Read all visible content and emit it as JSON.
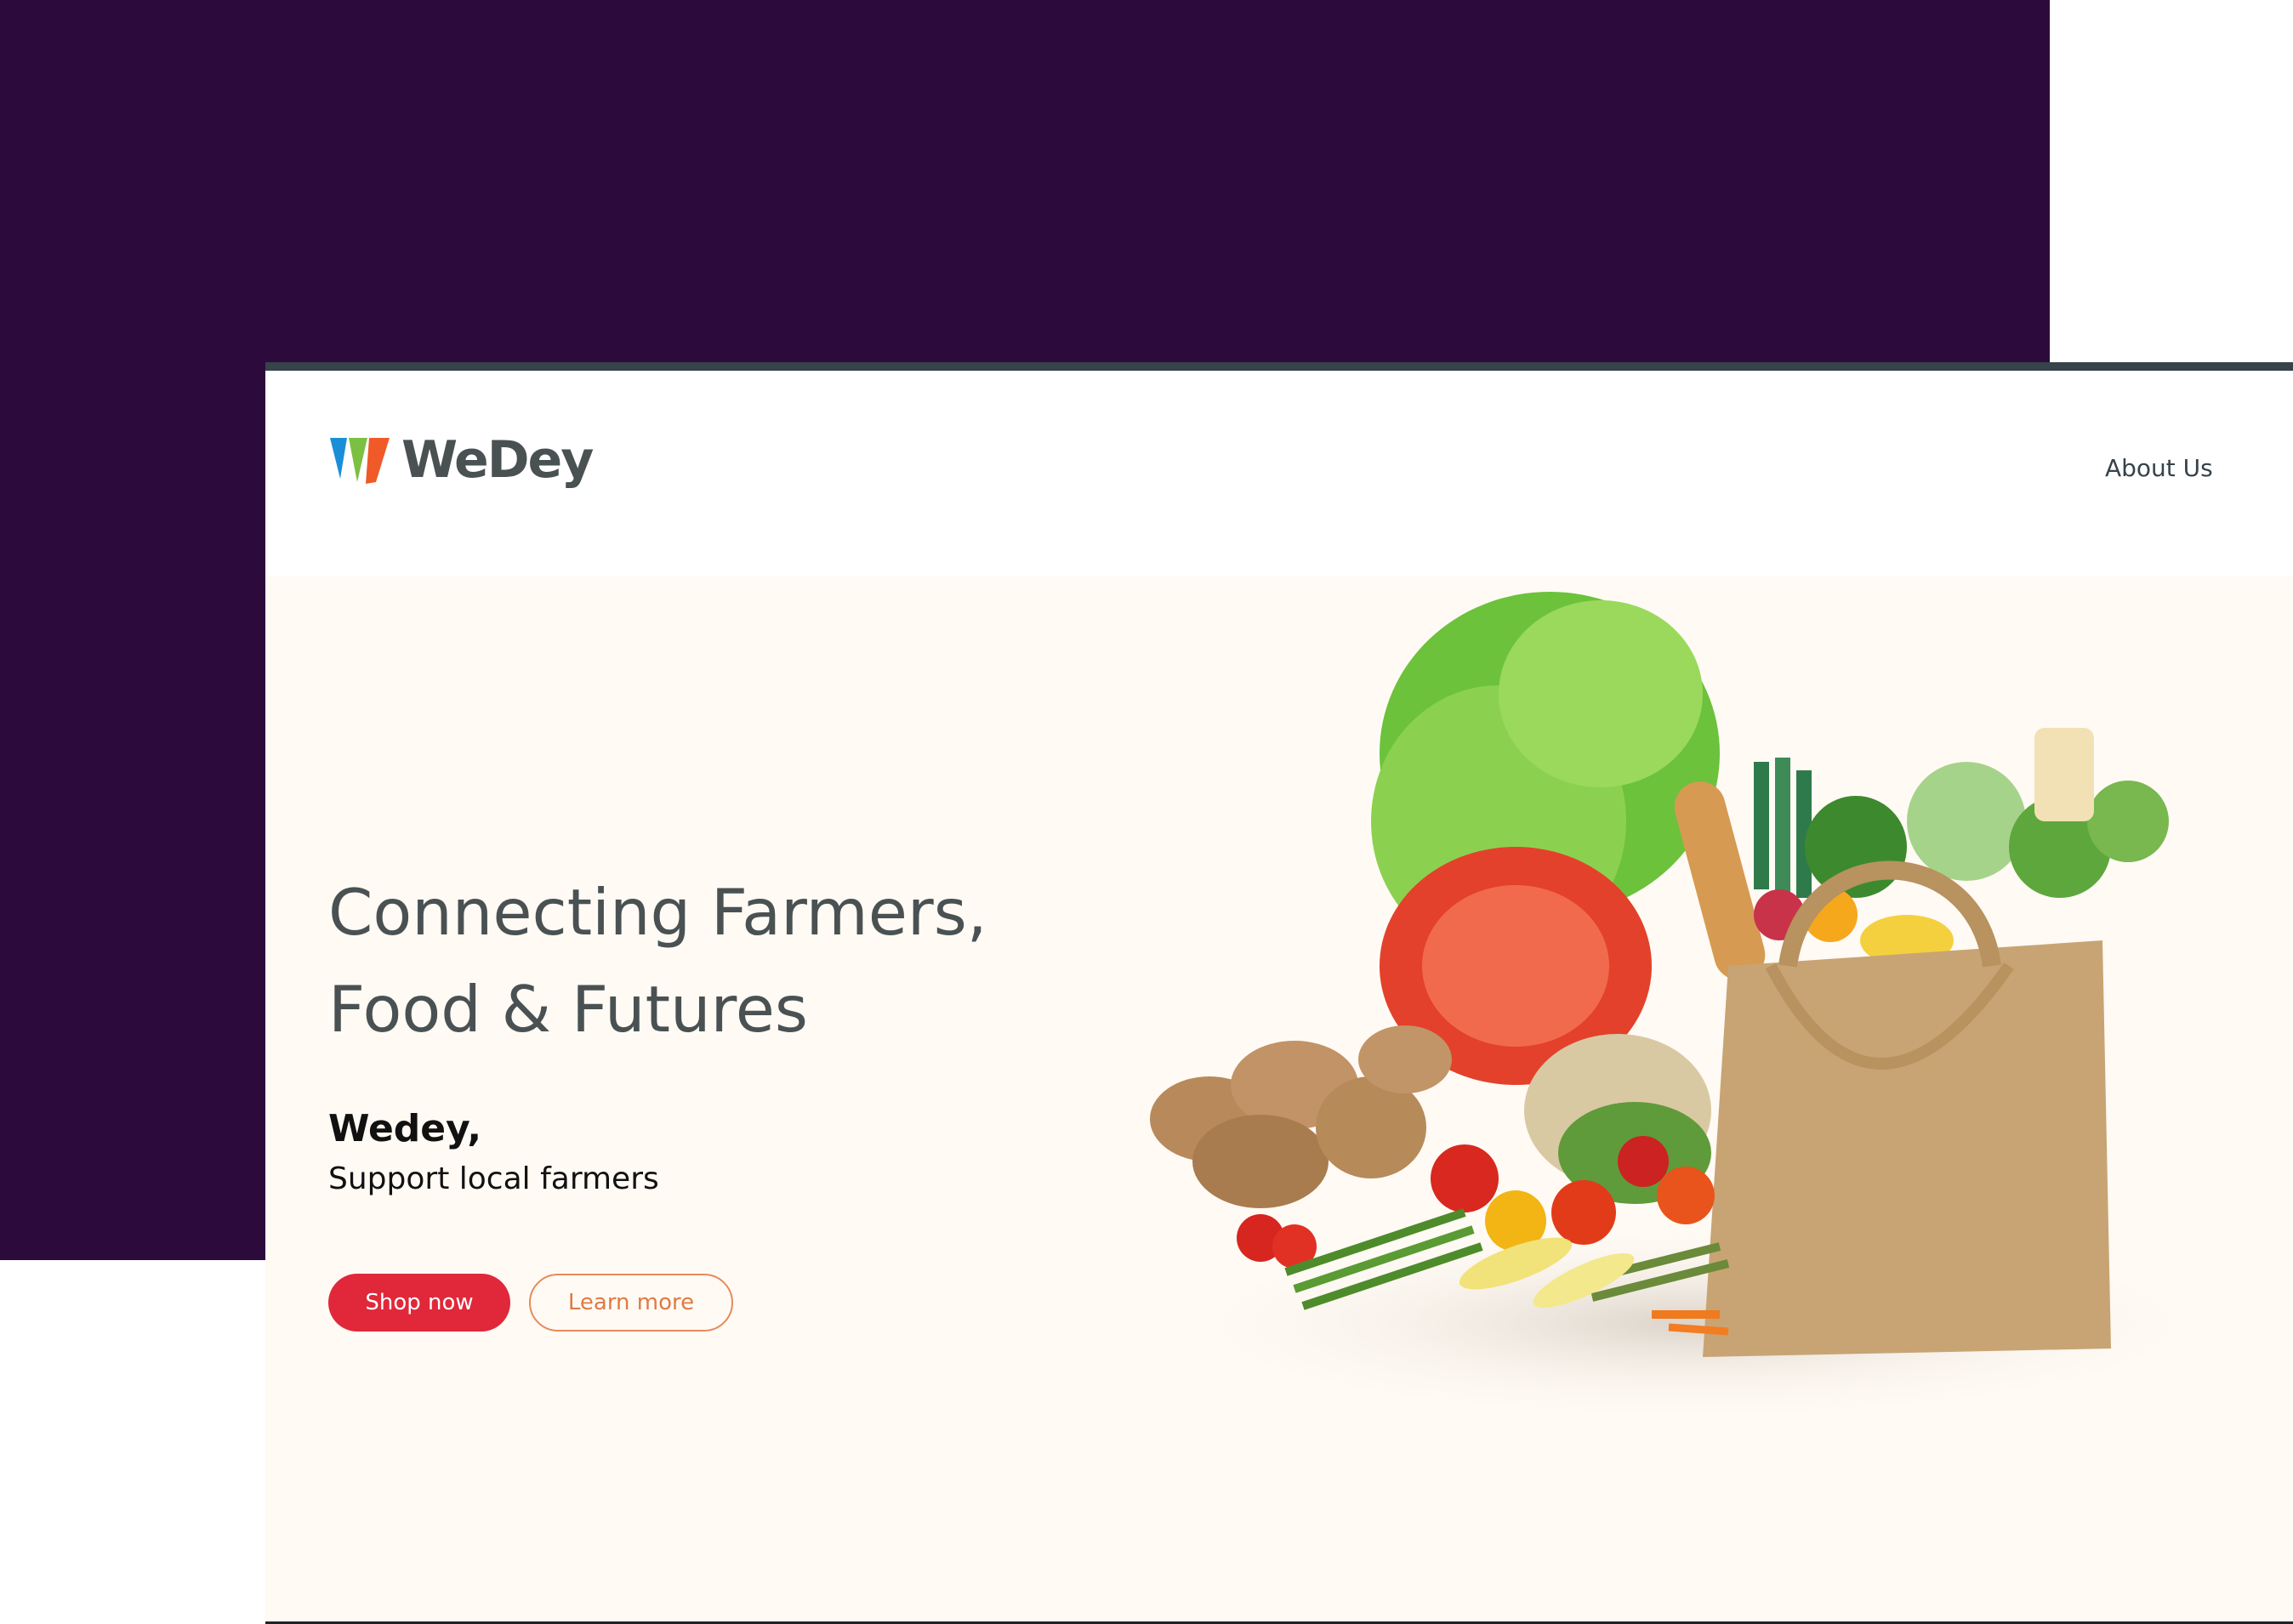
{
  "header": {
    "logo_text": "WeDey",
    "nav": {
      "about_label": "About Us"
    }
  },
  "hero": {
    "title_line1": "Connecting Farmers,",
    "title_line2": "Food & Futures",
    "brand": "Wedey,",
    "tagline": "Support local farmers",
    "shop_label": "Shop now",
    "learn_label": "Learn more"
  },
  "colors": {
    "background_block": "#2c0b3c",
    "hero_bg": "#fffaf4",
    "primary": "#e0283a",
    "secondary": "#e07a44",
    "text": "#4a5152"
  },
  "image": {
    "subject": "grocery-bag-with-vegetables"
  }
}
